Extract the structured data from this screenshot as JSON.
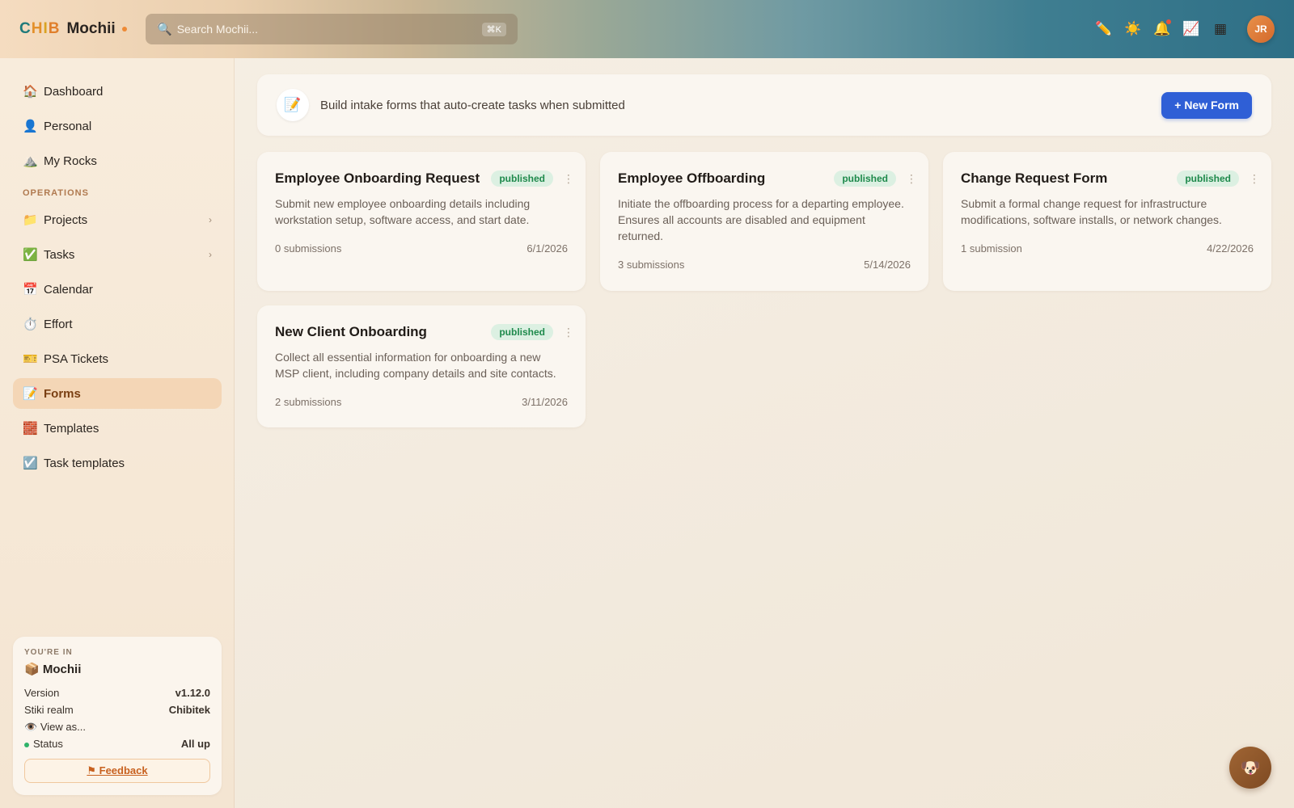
{
  "brand": {
    "prefix_c": "C",
    "prefix_h": "H",
    "prefix_i": "I",
    "prefix_b": "B",
    "name": "Mochii"
  },
  "search": {
    "placeholder": "Search Mochii...",
    "shortcut": "⌘K"
  },
  "top_icons": [
    "pencil-icon",
    "sun-icon",
    "bell-icon",
    "chart-icon",
    "grid-icon"
  ],
  "user": {
    "initials": "JR"
  },
  "sidebar": {
    "items_top": [
      {
        "label": "Dashboard",
        "icon": "🏠"
      },
      {
        "label": "Personal",
        "icon": "👤"
      },
      {
        "label": "My Rocks",
        "icon": "⛰️"
      }
    ],
    "section_label": "OPERATIONS",
    "items_ops": [
      {
        "label": "Projects",
        "icon": "📁",
        "chevron": "›"
      },
      {
        "label": "Tasks",
        "icon": "✅",
        "chevron": "›"
      },
      {
        "label": "Calendar",
        "icon": "📅"
      },
      {
        "label": "Effort",
        "icon": "⏱️"
      },
      {
        "label": "PSA Tickets",
        "icon": "🎫"
      },
      {
        "label": "Forms",
        "icon": "📝",
        "active": true
      },
      {
        "label": "Templates",
        "icon": "🧱"
      },
      {
        "label": "Task templates",
        "icon": "☑️"
      }
    ]
  },
  "context": {
    "label": "YOU'RE IN",
    "icon": "📦",
    "name": "Mochii",
    "version_label": "Version",
    "version_value": "v1.12.0",
    "realm_label": "Stiki realm",
    "realm_value": "Chibitek",
    "view_as_icon": "👁️",
    "view_as": "View as...",
    "status_label": "Status",
    "status_value": "All up",
    "feedback": "⚑ Feedback"
  },
  "banner": {
    "icon": "📝",
    "text": "Build intake forms that auto-create tasks when submitted",
    "button": "+ New Form"
  },
  "forms": [
    {
      "title": "Employee Onboarding Request",
      "status": "published",
      "description": "Submit new employee onboarding details including workstation setup, software access, and start date.",
      "submissions": "0 submissions",
      "date": "6/1/2026"
    },
    {
      "title": "Employee Offboarding",
      "status": "published",
      "description": "Initiate the offboarding process for a departing employee. Ensures all accounts are disabled and equipment returned.",
      "submissions": "3 submissions",
      "date": "5/14/2026"
    },
    {
      "title": "Change Request Form",
      "status": "published",
      "description": "Submit a formal change request for infrastructure modifications, software installs, or network changes.",
      "submissions": "1 submission",
      "date": "4/22/2026"
    },
    {
      "title": "New Client Onboarding",
      "status": "published",
      "description": "Collect all essential information for onboarding a new MSP client, including company details and site contacts.",
      "submissions": "2 submissions",
      "date": "3/11/2026"
    }
  ],
  "chat_icon": "🐶",
  "colors": {
    "accent": "#2f5fd6",
    "published": "#1f8a4c",
    "active_nav": "#f4d6b6"
  }
}
